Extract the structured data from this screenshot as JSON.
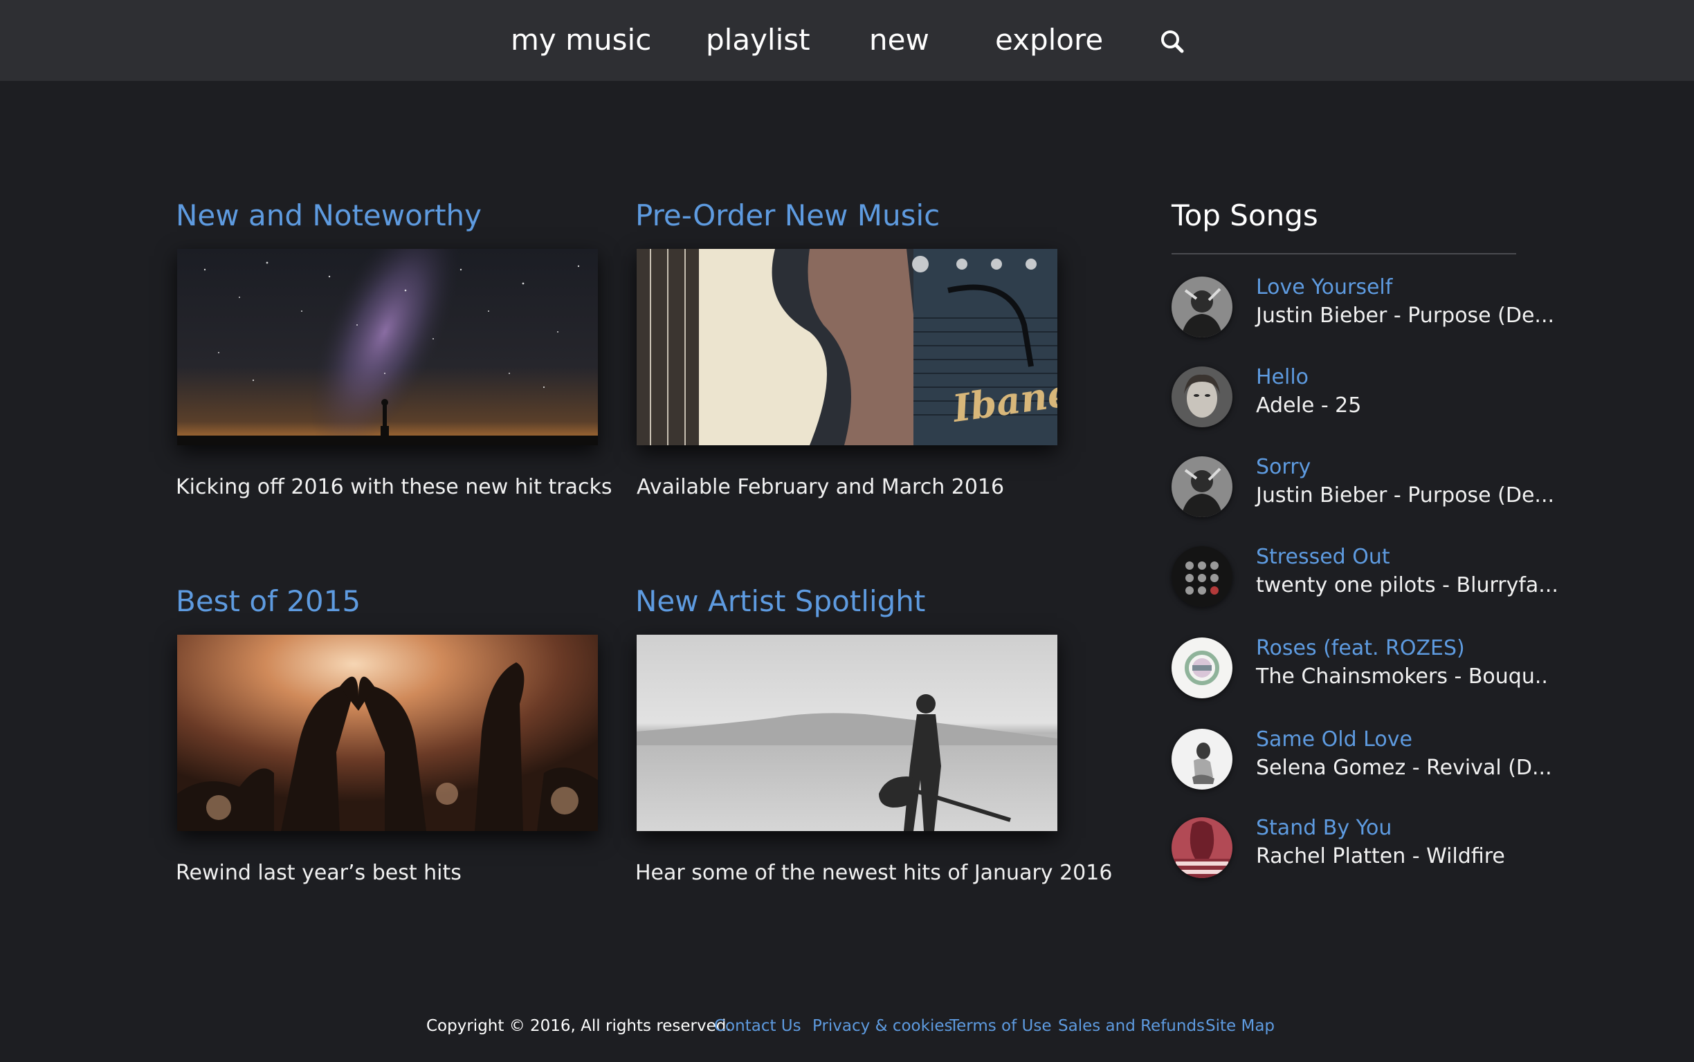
{
  "nav": {
    "items": [
      {
        "label": "my music"
      },
      {
        "label": "playlist"
      },
      {
        "label": "new"
      },
      {
        "label": "explore"
      }
    ],
    "search_icon": "search-icon"
  },
  "cards": [
    {
      "title": "New and Noteworthy",
      "caption": "Kicking off 2016 with these new hit tracks",
      "image": "milky-way-night-sky-photo"
    },
    {
      "title": "Pre-Order New Music",
      "caption": "Available February and March 2016",
      "image": "guitar-and-ibanez-amp-photo"
    },
    {
      "title": "Best of 2015",
      "caption": "Rewind last year’s best hits",
      "image": "concert-crowd-heart-hands-photo"
    },
    {
      "title": "New Artist Spotlight",
      "caption": "Hear some of the newest hits of January 2016",
      "image": "guitarist-desert-silhouette-photo"
    }
  ],
  "top_songs": {
    "title": "Top Songs",
    "songs": [
      {
        "title": "Love Yourself",
        "subtitle": "Justin Bieber - Purpose (De..."
      },
      {
        "title": "Hello",
        "subtitle": "Adele - 25"
      },
      {
        "title": "Sorry",
        "subtitle": "Justin Bieber - Purpose (De..."
      },
      {
        "title": "Stressed Out",
        "subtitle": "twenty one pilots - Blurryfa..."
      },
      {
        "title": "Roses (feat. ROZES)",
        "subtitle": "The Chainsmokers - Bouqu.."
      },
      {
        "title": "Same Old Love",
        "subtitle": "Selena Gomez - Revival (D..."
      },
      {
        "title": "Stand By You",
        "subtitle": "Rachel Platten - Wildfire"
      }
    ]
  },
  "footer": {
    "copyright": "Copyright © 2016, All rights reserved.",
    "links": [
      "Contact Us",
      "Privacy & cookies",
      "Terms of Use",
      "Sales and Refunds",
      "Site Map"
    ]
  },
  "colors": {
    "background": "#1d1e22",
    "nav_background": "#2e2f33",
    "accent_link": "#5e9be0",
    "text": "#ffffff"
  }
}
